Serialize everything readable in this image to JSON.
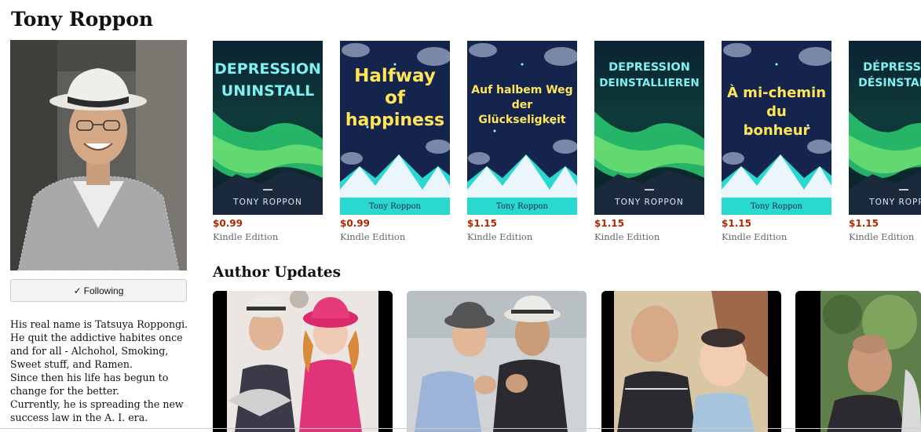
{
  "author": {
    "name": "Tony Roppon",
    "follow_label": "Following",
    "bio": [
      "His real name is Tatsuya Roppongi.",
      "He quit the addictive habites once",
      "and for all - Alchohol, Smoking,",
      "Sweet stuff, and Ramen.",
      "Since then his life has begun to",
      "change for the better.",
      "Currently, he is spreading the new",
      "success law in the A. I. era."
    ]
  },
  "books": [
    {
      "title": "DEPRESSION UNINSTALL",
      "title_lines": [
        "DEPRESSION",
        "UNINSTALL"
      ],
      "author_line": "TONY ROPPON",
      "style": "aurora",
      "price": "$0.99",
      "format": "Kindle Edition"
    },
    {
      "title": "Halfway of happiness",
      "title_lines": [
        "Halfway",
        "of",
        "happiness"
      ],
      "author_line": "Tony Roppon",
      "style": "mountain",
      "price": "$0.99",
      "format": "Kindle Edition"
    },
    {
      "title": "Auf halbem Weg der Glückseligkeit",
      "title_lines": [
        "Auf halbem Weg",
        "der",
        "Glückseligkeit"
      ],
      "author_line": "Tony Roppon",
      "style": "mountain",
      "price": "$1.15",
      "format": "Kindle Edition"
    },
    {
      "title": "DEPRESSION DEINSTALLIEREN",
      "title_lines": [
        "DEPRESSION",
        "DEINSTALLIEREN"
      ],
      "author_line": "TONY ROPPON",
      "style": "aurora",
      "price": "$1.15",
      "format": "Kindle Edition"
    },
    {
      "title": "À mi-chemin du bonheur",
      "title_lines": [
        "À mi-chemin",
        "du",
        "bonheur"
      ],
      "author_line": "Tony Roppon",
      "style": "mountain",
      "price": "$1.15",
      "format": "Kindle Edition"
    },
    {
      "title": "DÉPRESSION DÉSINSTALLER",
      "title_lines": [
        "DÉPRESSION",
        "DÉSINSTALLER"
      ],
      "author_line": "TONY ROPPON",
      "style": "aurora",
      "price": "$1.15",
      "format": "Kindle Edition"
    }
  ],
  "updates": {
    "title": "Author Updates"
  },
  "colors": {
    "price": "#b12704",
    "cover_navy": "#15244d",
    "aurora_green": "#2fe07a",
    "title_yellow": "#ffe55a",
    "title_cyan": "#7ff0f0",
    "mountain_teal": "#2ad8d2"
  }
}
